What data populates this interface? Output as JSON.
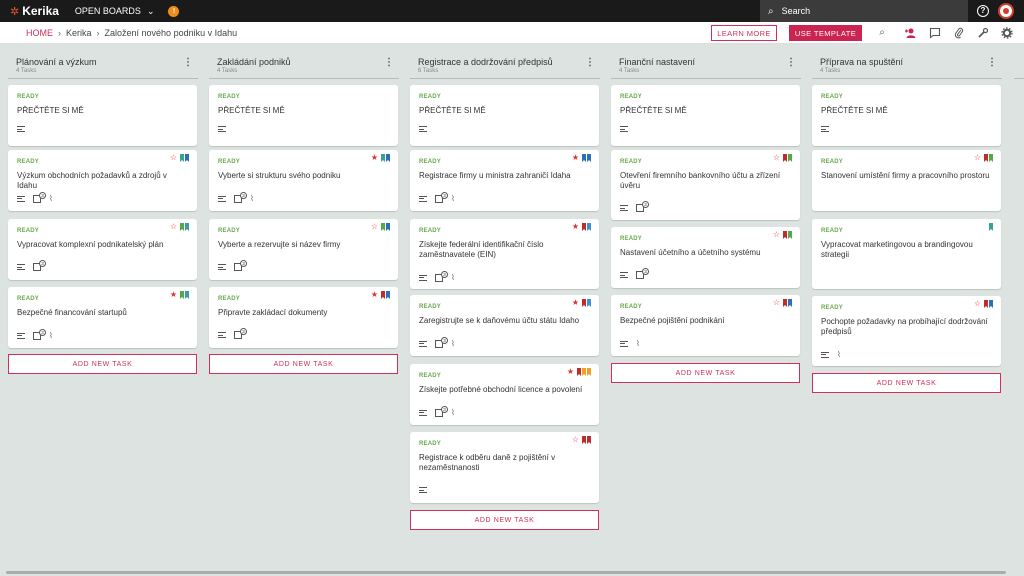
{
  "topbar": {
    "logo_text": "Kerika",
    "open_boards": "OPEN BOARDS",
    "notify_count": "!",
    "search_label": "Search"
  },
  "breadcrumb": {
    "home": "HOME",
    "org": "Kerika",
    "board": "Založení nového podniku v Idahu"
  },
  "toolbar": {
    "learn_more": "LEARN MORE",
    "use_template": "USE TEMPLATE"
  },
  "colors": {
    "red": "#cc2450",
    "blue": "#2b6fb7",
    "teal": "#3aa09a",
    "green": "#55a84a",
    "darkred": "#c02b2b",
    "orange": "#f0a024",
    "sky": "#3d8fd6"
  },
  "add_task_label": "ADD NEW TASK",
  "ready_label": "READY",
  "columns": [
    {
      "title": "Plánování a výzkum",
      "count": "4 Tasks",
      "cards": [
        {
          "title": "PŘEČTĚTE SI MĚ"
        },
        {
          "title": "Výzkum obchodních požadavků a zdrojů v Idahu",
          "check": "3"
        },
        {
          "title": "Vypracovat komplexní podnikatelský plán",
          "check": "3"
        },
        {
          "title": "Bezpečné financování startupů",
          "check": "3"
        }
      ]
    },
    {
      "title": "Zakládání podniků",
      "count": "4 Tasks",
      "cards": [
        {
          "title": "PŘEČTĚTE SI MĚ"
        },
        {
          "title": "Vyberte si strukturu svého podniku",
          "check": "3"
        },
        {
          "title": "Vyberte a rezervujte si název firmy",
          "check": "3"
        },
        {
          "title": "Připravte zakládací dokumenty",
          "check": "3"
        }
      ]
    },
    {
      "title": "Registrace a dodržování předpisů",
      "count": "6 Tasks",
      "cards": [
        {
          "title": "PŘEČTĚTE SI MĚ"
        },
        {
          "title": "Registrace firmy u ministra zahraničí Idaha",
          "check": "3"
        },
        {
          "title": "Získejte federální identifikační číslo zaměstnavatele (EIN)",
          "check": "3"
        },
        {
          "title": "Zaregistrujte se k daňovému účtu státu Idaho",
          "check": "3"
        },
        {
          "title": "Získejte potřebné obchodní licence a povolení",
          "check": "3"
        },
        {
          "title": "Registrace k odběru daně z pojištění v nezaměstnanosti"
        }
      ]
    },
    {
      "title": "Finanční nastavení",
      "count": "4 Tasks",
      "cards": [
        {
          "title": "PŘEČTĚTE SI MĚ"
        },
        {
          "title": "Otevření firemního bankovního účtu a zřízení úvěru",
          "check": "3"
        },
        {
          "title": "Nastavení účetního a účetního systému",
          "check": "3"
        },
        {
          "title": "Bezpečné pojištění podnikání"
        }
      ]
    },
    {
      "title": "Příprava na spuštění",
      "count": "4 Tasks",
      "cards": [
        {
          "title": "PŘEČTĚTE SI MĚ"
        },
        {
          "title": "Stanovení umístění firmy a pracovního prostoru"
        },
        {
          "title": "Vypracovat marketingovou a brandingovou strategii"
        },
        {
          "title": "Pochopte požadavky na probíhající dodržování předpisů"
        }
      ]
    }
  ]
}
